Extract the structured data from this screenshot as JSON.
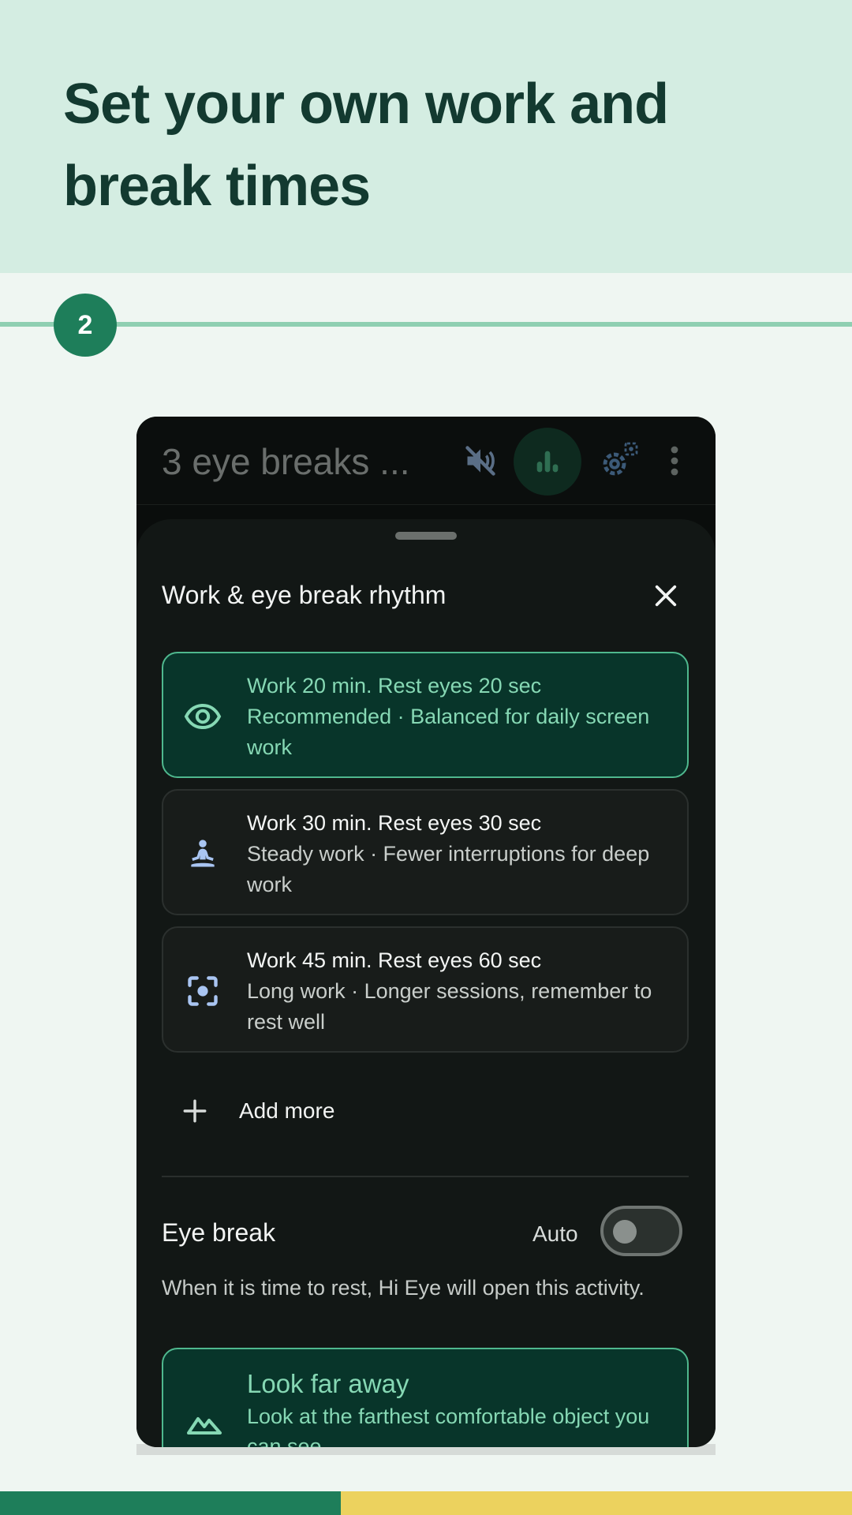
{
  "hero": {
    "title": "Set your own work and break times"
  },
  "step": {
    "number": "2"
  },
  "app": {
    "title": "3 eye breaks ...",
    "icons": [
      "mute-icon",
      "stats-icon",
      "settings-icon",
      "more-icon"
    ]
  },
  "sheet": {
    "title": "Work & eye break rhythm",
    "options": [
      {
        "title": "Work 20 min. Rest eyes 20 sec",
        "desc": "Recommended · Balanced for daily screen work",
        "icon": "eye-icon",
        "selected": true
      },
      {
        "title": "Work 30 min. Rest eyes 30 sec",
        "desc": "Steady work · Fewer interruptions for deep work",
        "icon": "meditation-icon",
        "selected": false
      },
      {
        "title": "Work 45 min. Rest eyes 60 sec",
        "desc": "Long work · Longer sessions, remember to rest well",
        "icon": "focus-icon",
        "selected": false
      }
    ],
    "add_more": "Add more",
    "eye_break": {
      "title": "Eye break",
      "auto_label": "Auto",
      "auto_on": false,
      "desc": "When it is time to rest, Hi Eye will open this activity."
    },
    "activity": {
      "title": "Look far away",
      "desc": "Look at the farthest comfortable object you can see",
      "icon": "landscape-icon"
    }
  },
  "colors": {
    "accent": "#1e7e5a",
    "highlight": "#86d8b4",
    "footer_yellow": "#ecd25e"
  }
}
